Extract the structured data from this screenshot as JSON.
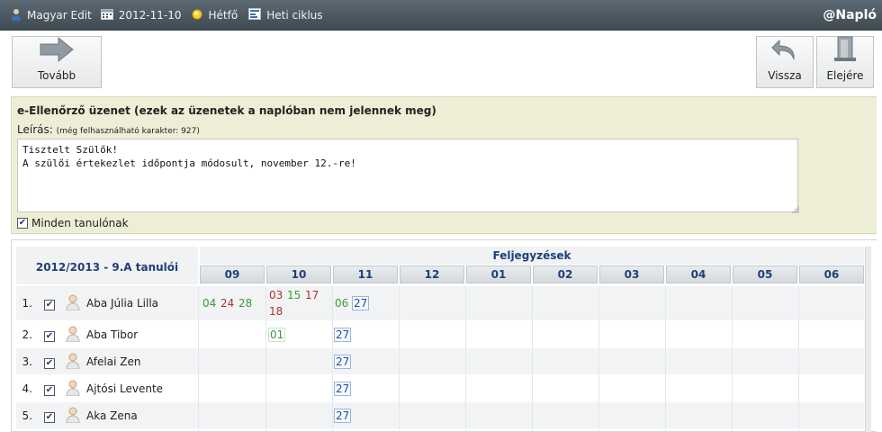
{
  "topbar": {
    "user": "Magyar Edit",
    "date": "2012-11-10",
    "day": "Hétfő",
    "cycle": "Heti ciklus",
    "brand": "@Napló"
  },
  "toolbar": {
    "next_label": "Tovább",
    "back_label": "Vissza",
    "start_label": "Elejére"
  },
  "message": {
    "title": "e-Ellenőrző üzenet (ezek az üzenetek a naplóban nem jelennek meg)",
    "desc_label": "Leírás:",
    "desc_note": "(még felhasználható karakter: 927)",
    "text": "Tisztelt Szülők!\nA szülői értekezlet időpontja módosult, november 12.-re!",
    "all_students_label": "Minden tanulónak"
  },
  "grid": {
    "class_title": "2012/2013 - 9.A tanulói",
    "records_title": "Feljegyzések",
    "months": [
      "09",
      "10",
      "11",
      "12",
      "01",
      "02",
      "03",
      "04",
      "05",
      "06"
    ],
    "students": [
      {
        "num": "1.",
        "name": "Aba Júlia Lilla"
      },
      {
        "num": "2.",
        "name": "Aba Tibor"
      },
      {
        "num": "3.",
        "name": "Afelai Zen"
      },
      {
        "num": "4.",
        "name": "Ajtósi Levente"
      },
      {
        "num": "5.",
        "name": "Aka Zena"
      }
    ],
    "marks": {
      "r1": {
        "m09": [
          "04",
          "24",
          "28"
        ],
        "m10": [
          "03",
          "15",
          "17",
          "18"
        ],
        "m11": [
          "06",
          "27"
        ]
      },
      "r2": {
        "m10": [
          "01"
        ],
        "m11": [
          "27"
        ]
      },
      "r3": {
        "m11": [
          "27"
        ]
      },
      "r4": {
        "m11": [
          "27"
        ]
      },
      "r5": {
        "m11": [
          "27"
        ]
      }
    }
  },
  "colors": {
    "topbar": "#4a555e",
    "header_text": "#1f3f7a",
    "panel_bg": "#eeeed6",
    "mark_green": "#3a9a36",
    "mark_red": "#b03030",
    "mark_blue": "#1f4fa0"
  },
  "icons": [
    "user-icon",
    "calendar-icon",
    "sun-icon",
    "cycle-icon",
    "arrow-right-icon",
    "undo-icon",
    "door-icon",
    "student-avatar-icon"
  ]
}
